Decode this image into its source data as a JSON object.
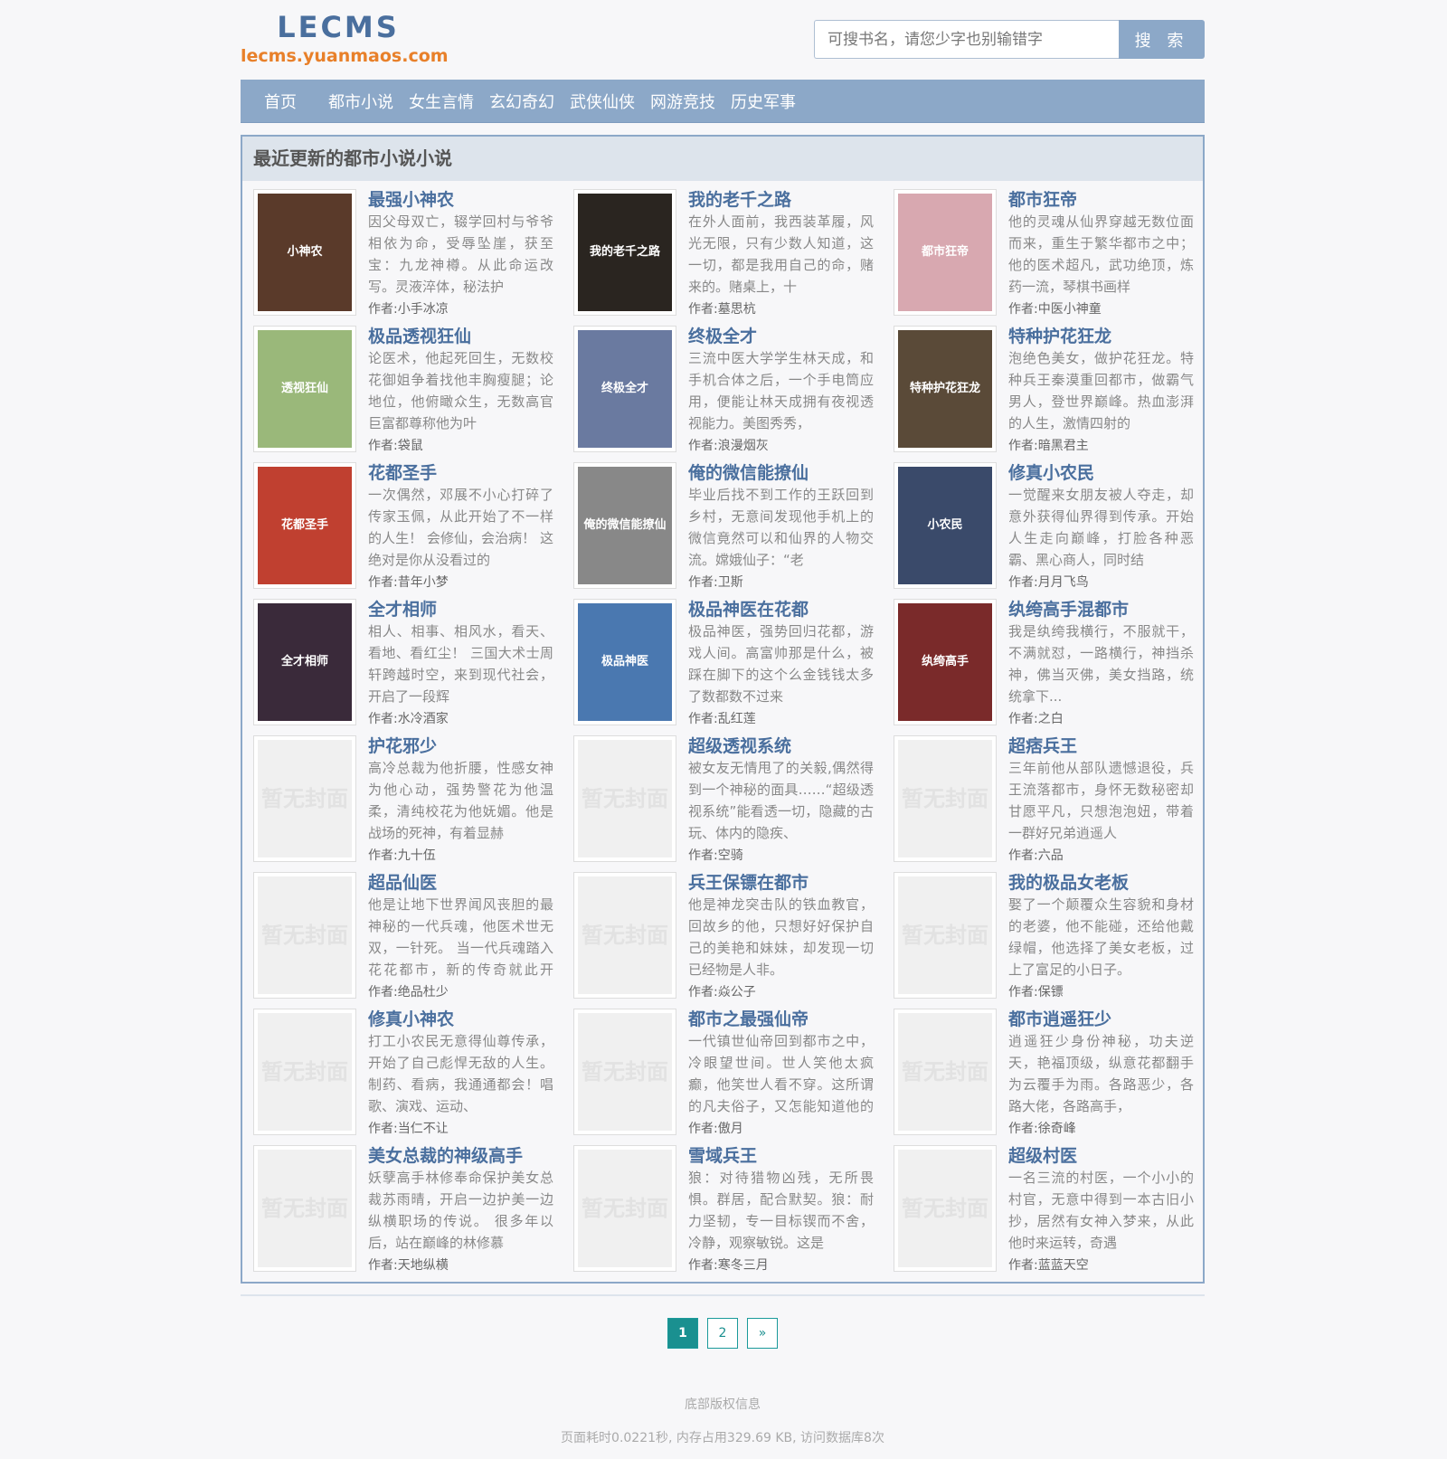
{
  "header": {
    "logo_title": "LECMS",
    "logo_url": "lecms.yuanmaos.com",
    "search_placeholder": "可搜书名，请您少字也别输错字",
    "search_button": "搜 索"
  },
  "nav": [
    "首页",
    "都市小说",
    "女生言情",
    "玄幻奇幻",
    "武侠仙侠",
    "网游竞技",
    "历史军事"
  ],
  "panel_title": "最近更新的都市小说小说",
  "books": [
    {
      "title": "最强小神农",
      "desc": "因父母双亡，辍学回村与爷爷相依为命，受辱坠崖，获至宝：九龙神樽。从此命运改写。灵液淬体，秘法护",
      "author": "作者:小手冰凉",
      "cover": "小神农",
      "cover_color": "#5a3a2a"
    },
    {
      "title": "我的老千之路",
      "desc": "在外人面前，我西装革履，风光无限，只有少数人知道，这一切，都是我用自己的命，赌来的。赌桌上，十",
      "author": "作者:墓思杭",
      "cover": "我的老千之路",
      "cover_color": "#2a2520"
    },
    {
      "title": "都市狂帝",
      "desc": "他的灵魂从仙界穿越无数位面而来，重生于繁华都市之中；他的医术超凡，武功绝顶，炼药一流，琴棋书画样",
      "author": "作者:中医小神童",
      "cover": "都市狂帝",
      "cover_color": "#d8a8b0"
    },
    {
      "title": "极品透视狂仙",
      "desc": "论医术，他起死回生，无数校花御姐争着找他丰胸瘦腿；论地位，他俯瞰众生，无数高官巨富都尊称他为叶",
      "author": "作者:袋鼠",
      "cover": "透视狂仙",
      "cover_color": "#9ab87a"
    },
    {
      "title": "终极全才",
      "desc": "三流中医大学学生林天成，和手机合体之后，一个手电筒应用，便能让林天成拥有夜视透视能力。美图秀秀，",
      "author": "作者:浪漫烟灰",
      "cover": "终极全才",
      "cover_color": "#6a7aa0"
    },
    {
      "title": "特种护花狂龙",
      "desc": "泡绝色美女，做护花狂龙。特种兵王秦漠重回都市，做霸气男人，登世界巅峰。热血澎湃的人生，激情四射的",
      "author": "作者:暗黑君主",
      "cover": "特种护花狂龙",
      "cover_color": "#5a4a38"
    },
    {
      "title": "花都圣手",
      "desc": "一次偶然，邓展不小心打碎了传家玉佩，从此开始了不一样的人生！ 会修仙，会治病！ 这绝对是你从没看过的",
      "author": "作者:昔年小梦",
      "cover": "花都圣手",
      "cover_color": "#c04030"
    },
    {
      "title": "俺的微信能撩仙",
      "desc": "毕业后找不到工作的王跃回到乡村，无意间发现他手机上的微信竟然可以和仙界的人物交流。嫦娥仙子：“老",
      "author": "作者:卫斯",
      "cover": "俺的微信能撩仙",
      "cover_color": "#888888"
    },
    {
      "title": "修真小农民",
      "desc": "一觉醒来女朋友被人夺走，却意外获得仙界得到传承。开始人生走向巅峰，打脸各种恶霸、黑心商人，同时结",
      "author": "作者:月月飞鸟",
      "cover": "小农民",
      "cover_color": "#3a4a6a"
    },
    {
      "title": "全才相师",
      "desc": "相人、相事、相风水，看天、看地、看红尘！ 三国大术士周轩跨越时空，来到现代社会，开启了一段辉",
      "author": "作者:水冷酒家",
      "cover": "全才相师",
      "cover_color": "#3a2a3a"
    },
    {
      "title": "极品神医在花都",
      "desc": "极品神医，强势回归花都，游戏人间。高富帅那是什么，被踩在脚下的这个么金钱钱太多了数都数不过来",
      "author": "作者:乱红莲",
      "cover": "极品神医",
      "cover_color": "#4a78b0"
    },
    {
      "title": "纨绔高手混都市",
      "desc": "我是纨绔我横行，不服就干，不满就怼，一路横行，神挡杀神，佛当灭佛，美女挡路，统统拿下...",
      "author": "作者:之白",
      "cover": "纨绔高手",
      "cover_color": "#7a2a2a"
    },
    {
      "title": "护花邪少",
      "desc": "高冷总裁为他折腰，性感女神为他心动，强势警花为他温柔，清纯校花为他妩媚。他是战场的死神，有着显赫",
      "author": "作者:九十伍",
      "cover": "暂无封面",
      "cover_color": ""
    },
    {
      "title": "超级透视系统",
      "desc": "被女友无情甩了的关毅,偶然得到一个神秘的面具……“超级透视系统”能看透一切，隐藏的古玩、体内的隐疾、",
      "author": "作者:空骑",
      "cover": "暂无封面",
      "cover_color": ""
    },
    {
      "title": "超痞兵王",
      "desc": "三年前他从部队遗憾退役，兵王流落都市，身怀无数秘密却甘愿平凡，只想泡泡妞，带着一群好兄弟逍遥人",
      "author": "作者:六品",
      "cover": "暂无封面",
      "cover_color": ""
    },
    {
      "title": "超品仙医",
      "desc": "他是让地下世界闻风丧胆的最神秘的一代兵魂，他医术世无双，一针死。 当一代兵魂踏入花花都市，新的传奇就此开始。",
      "author": "作者:绝品杜少",
      "cover": "暂无封面",
      "cover_color": ""
    },
    {
      "title": "兵王保镖在都市",
      "desc": "他是神龙突击队的铁血教官，回故乡的他，只想好好保护自己的美艳和妹妹，却发现一切已经物是人非。",
      "author": "作者:焱公子",
      "cover": "暂无封面",
      "cover_color": ""
    },
    {
      "title": "我的极品女老板",
      "desc": "娶了一个颠覆众生容貌和身材的老婆，他不能碰，还给他戴绿帽，他选择了美女老板，过上了富足的小日子。",
      "author": "作者:保镖",
      "cover": "暂无封面",
      "cover_color": ""
    },
    {
      "title": "修真小神农",
      "desc": "打工小农民无意得仙尊传承，开始了自己彪悍无敌的人生。制药、看病，我通通都会！唱歌、演戏、运动、",
      "author": "作者:当仁不让",
      "cover": "暂无封面",
      "cover_color": ""
    },
    {
      "title": "都市之最强仙帝",
      "desc": "一代镇世仙帝回到都市之中，冷眼望世间。世人笑他太疯癫，他笑世人看不穿。这所谓的凡夫俗子，又怎能知道他的世界这是一个仙人回归都市，俯瞰众生蝼蚁的故事。",
      "author": "作者:傲月",
      "cover": "暂无封面",
      "cover_color": ""
    },
    {
      "title": "都市逍遥狂少",
      "desc": "逍遥狂少身份神秘，功夫逆天，艳福顶级，纵意花都翻手为云覆手为雨。各路恶少，各路大佬，各路高手，",
      "author": "作者:徐奇峰",
      "cover": "暂无封面",
      "cover_color": ""
    },
    {
      "title": "美女总裁的神级高手",
      "desc": "妖孽高手林修奉命保护美女总裁苏雨晴，开启一边护美一边纵横职场的传说。 很多年以后，站在巅峰的林修慕",
      "author": "作者:天地纵横",
      "cover": "暂无封面",
      "cover_color": ""
    },
    {
      "title": "雪域兵王",
      "desc": "狼：对待猎物凶残，无所畏惧。群居，配合默契。狼：耐力坚韧，专一目标锲而不舍，冷静，观察敏锐。这是",
      "author": "作者:寒冬三月",
      "cover": "暂无封面",
      "cover_color": ""
    },
    {
      "title": "超级村医",
      "desc": "一名三流的村医，一个小小的村官，无意中得到一本古旧小抄，居然有女神入梦来，从此他时来运转，奇遇",
      "author": "作者:蓝蓝天空",
      "cover": "暂无封面",
      "cover_color": ""
    }
  ],
  "pager": [
    "1",
    "2",
    "»"
  ],
  "footer": {
    "copyright": "底部版权信息",
    "stats": "页面耗时0.0221秒, 内存占用329.69 KB, 访问数据库8次"
  }
}
